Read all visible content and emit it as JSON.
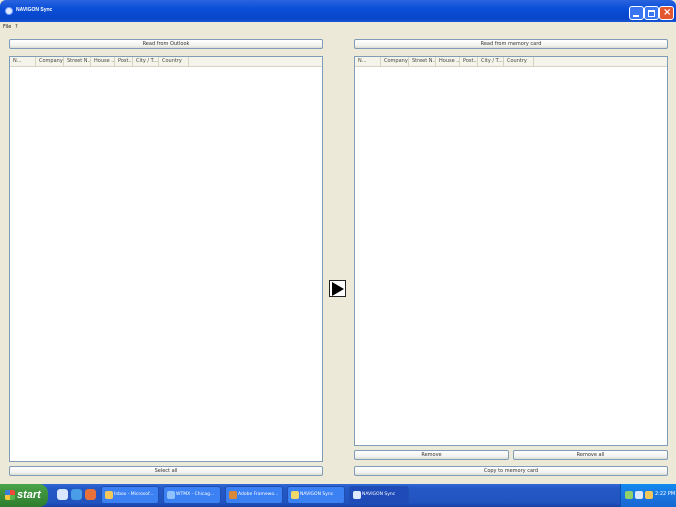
{
  "window": {
    "title": "NAVIGON Sync",
    "controls": [
      "minimize",
      "maximize",
      "close"
    ]
  },
  "menu": [
    "File",
    "?"
  ],
  "left_panel": {
    "read_button": "Read from Outlook",
    "columns": [
      "N...",
      "Company",
      "Street N...",
      "House ...",
      "Post...",
      "City / T...",
      "Country"
    ],
    "select_all_button": "Select all"
  },
  "transfer_button_icon": "right-arrow-icon",
  "right_panel": {
    "read_button": "Read from memory card",
    "columns": [
      "N...",
      "Company",
      "Street N...",
      "House ...",
      "Post...",
      "City / T...",
      "Country"
    ],
    "remove_button": "Remove",
    "remove_all_button": "Remove all",
    "copy_button": "Copy to memory card"
  },
  "taskbar": {
    "start_label": "start",
    "tasks": [
      "Inbox - Microsof...",
      "WTMX - Chicag...",
      "Adobe Framewo...",
      "NAVIGON Sync",
      "NAVIGON Sync"
    ],
    "clock": "2:22 PM"
  }
}
